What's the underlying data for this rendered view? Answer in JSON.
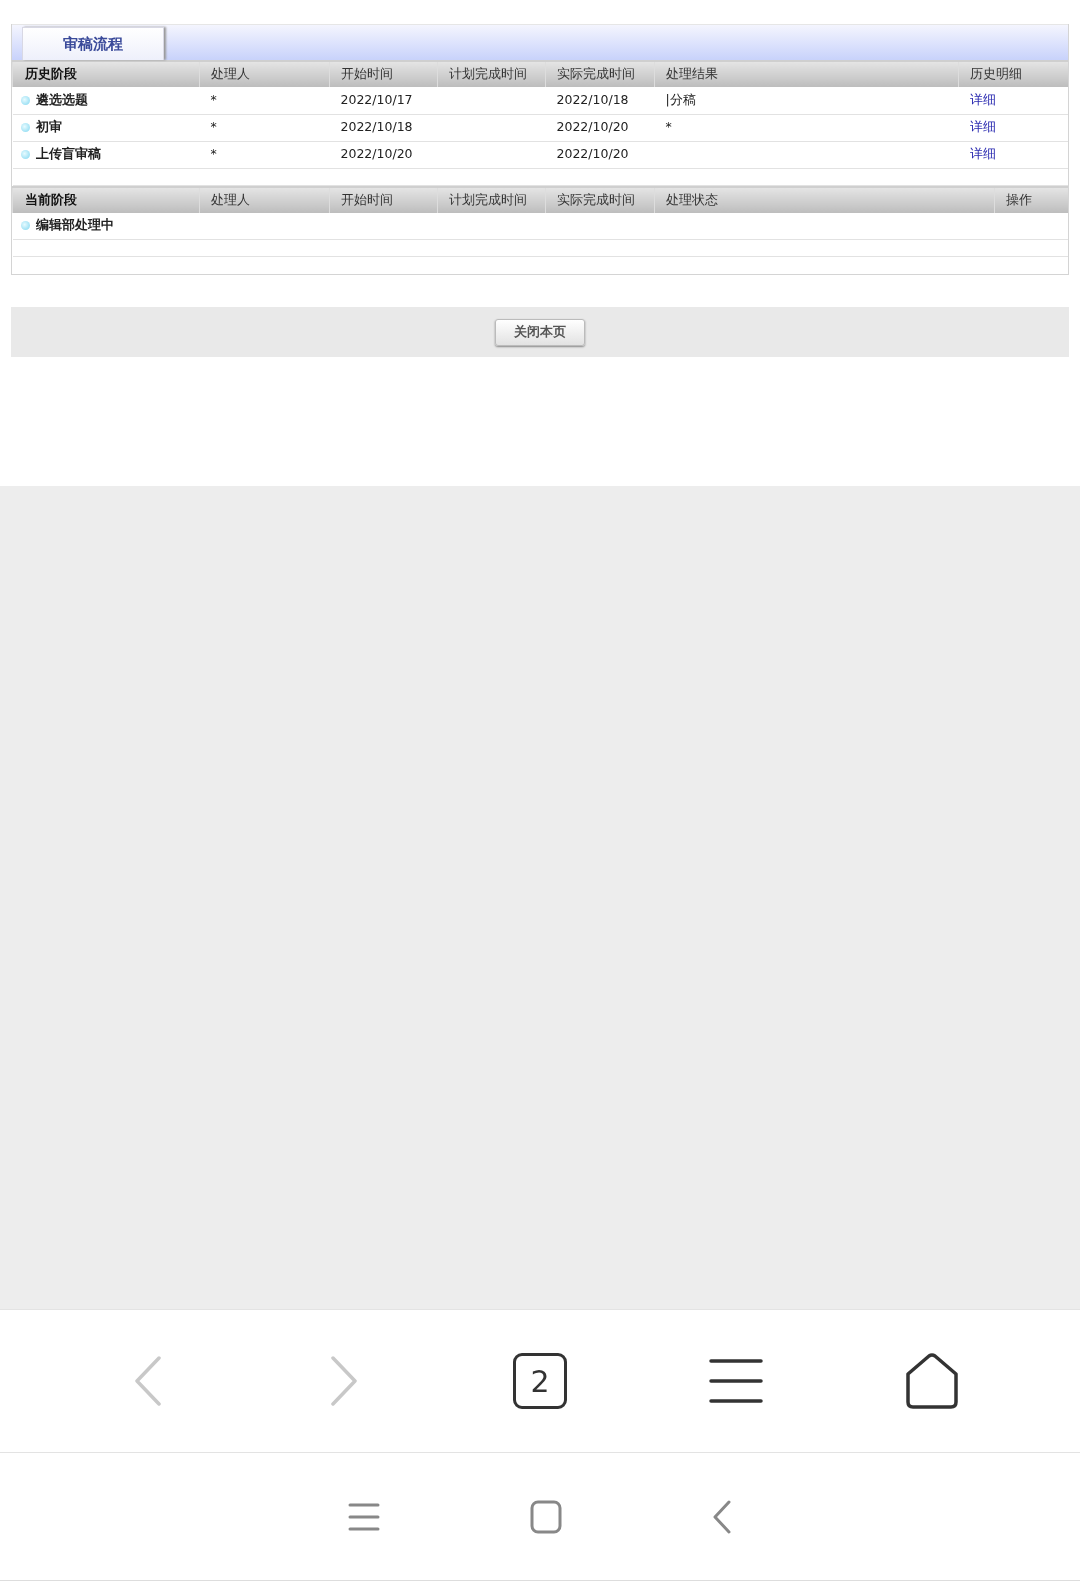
{
  "tab": {
    "label": "审稿流程",
    "selected": true
  },
  "history": {
    "columns": [
      "历史阶段",
      "处理人",
      "开始时间",
      "计划完成时间",
      "实际完成时间",
      "处理结果",
      "历史明细"
    ],
    "rows": [
      {
        "stage": "遴选选题",
        "handler": "*",
        "start": "2022/10/17",
        "actual": "2022/10/18",
        "result": "|分稿",
        "detail": "详细"
      },
      {
        "stage": "初审",
        "handler": "*",
        "start": "2022/10/18",
        "actual": "2022/10/20",
        "result": "*",
        "detail": "详细"
      },
      {
        "stage": "上传盲审稿",
        "handler": "*",
        "start": "2022/10/20",
        "actual": "2022/10/20",
        "detail": "详细"
      }
    ]
  },
  "current": {
    "columns": [
      "当前阶段",
      "处理人",
      "开始时间",
      "计划完成时间",
      "实际完成时间",
      "处理状态",
      "操作"
    ],
    "rows": [
      {
        "stage": "编辑部处理中"
      }
    ]
  },
  "close_button": "关闭本页",
  "browser_toolbar": {
    "back": {
      "disabled": true
    },
    "forward": {
      "disabled": true
    },
    "tab_count": "2"
  }
}
